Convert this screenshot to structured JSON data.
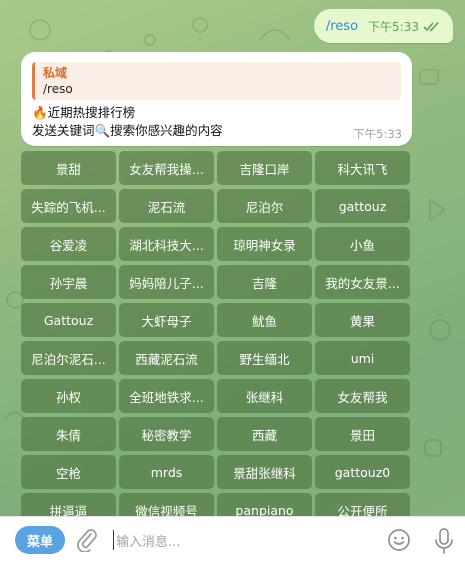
{
  "outgoing": {
    "text": "/reso",
    "time": "下午5:33",
    "status_icon": "double-check-icon"
  },
  "incoming": {
    "quote_name": "私域",
    "quote_text": "/reso",
    "line1": "🔥近期热搜排行榜",
    "line2": "发送关键词🔍搜索你感兴趣的内容",
    "time": "下午5:33"
  },
  "keyboard": {
    "buttons": [
      "景甜",
      "女友帮我操...",
      "吉隆口岸",
      "科大讯飞",
      "失踪的飞机...",
      "泥石流",
      "尼泊尔",
      "gattouz",
      "谷爱凌",
      "湖北科技大...",
      "琼明神女录",
      "小鱼",
      "孙宇晨",
      "妈妈陪儿子...",
      "吉隆",
      "我的女友景...",
      "Gattouz",
      "大虾母子",
      "鱿鱼",
      "黄果",
      "尼泊尔泥石...",
      "西藏泥石流",
      "野生缅北",
      "umi",
      "孙权",
      "全班地铁求...",
      "张继科",
      "女友帮我",
      "朱倩",
      "秘密教学",
      "西藏",
      "景田",
      "空枪",
      "mrds",
      "景甜张继科",
      "gattouz0",
      "拼逼逼",
      "微信视频号",
      "panpiano",
      "公开便所"
    ]
  },
  "input_bar": {
    "menu_label": "菜单",
    "placeholder": "输入消息...",
    "icons": [
      "paperclip-icon",
      "emoji-icon",
      "microphone-icon"
    ]
  },
  "colors": {
    "accent": "#5aa3e2",
    "outgoing_bg": "#e7f8cf",
    "keyboard_button": "#4c703c",
    "quote_accent": "#e07b45"
  }
}
